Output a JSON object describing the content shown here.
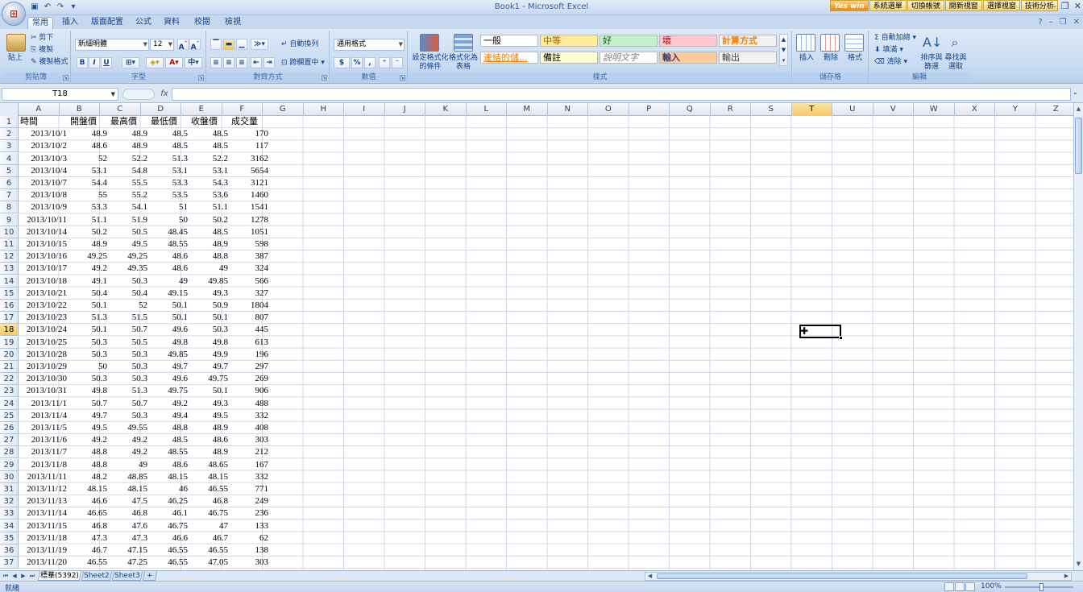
{
  "window": {
    "title": "Book1 - Microsoft Excel",
    "addins": [
      "Yes win",
      "系統選單",
      "切換帳號",
      "開新視窗",
      "選擇視窗",
      "技術分析"
    ]
  },
  "tabs": [
    "常用",
    "插入",
    "版面配置",
    "公式",
    "資料",
    "校閱",
    "檢視"
  ],
  "ribbon": {
    "clipboard": {
      "paste": "貼上",
      "cut": "剪下",
      "copy": "複製",
      "format_painter": "複製格式",
      "label": "剪貼簿"
    },
    "font": {
      "name": "新細明體",
      "size": "12",
      "label": "字型",
      "bold": "B",
      "italic": "I",
      "underline": "U"
    },
    "alignment": {
      "wrap": "自動換列",
      "merge": "跨欄置中",
      "label": "對齊方式"
    },
    "number": {
      "format": "通用格式",
      "label": "數值",
      "currency": "$",
      "percent": "%",
      "comma": ","
    },
    "styles": {
      "conditional": "設定格式化的條件",
      "as_table": "格式化為表格",
      "label": "樣式",
      "cells": [
        {
          "text": "一般",
          "bg": "#ffffff",
          "color": "#000000"
        },
        {
          "text": "中等",
          "bg": "#ffeb9c",
          "color": "#9c6500"
        },
        {
          "text": "好",
          "bg": "#c6efce",
          "color": "#006100"
        },
        {
          "text": "壞",
          "bg": "#ffc7ce",
          "color": "#9c0006"
        },
        {
          "text": "計算方式",
          "bg": "#f2f2f2",
          "color": "#fa7d00"
        },
        {
          "text": "連結的儲...",
          "bg": "#ffffff",
          "color": "#fa7d00"
        },
        {
          "text": "備註",
          "bg": "#ffffcc",
          "color": "#000000"
        },
        {
          "text": "說明文字",
          "bg": "#ffffff",
          "color": "#7f7f7f"
        },
        {
          "text": "輸入",
          "bg": "#ffcc99",
          "color": "#3f3f76"
        },
        {
          "text": "輸出",
          "bg": "#f2f2f2",
          "color": "#3f3f3f"
        }
      ]
    },
    "cells_group": {
      "insert": "插入",
      "delete": "刪除",
      "format": "格式",
      "label": "儲存格"
    },
    "editing": {
      "autosum": "自動加總",
      "fill": "填滿",
      "clear": "清除",
      "sort": "排序與篩選",
      "find": "尋找與選取",
      "label": "編輯"
    }
  },
  "formula_bar": {
    "name_box": "T18",
    "fx": "fx",
    "value": ""
  },
  "columns": [
    "A",
    "B",
    "C",
    "D",
    "E",
    "F",
    "G",
    "H",
    "I",
    "J",
    "K",
    "L",
    "M",
    "N",
    "O",
    "P",
    "Q",
    "R",
    "S",
    "T",
    "U",
    "V",
    "W",
    "X",
    "Y",
    "Z"
  ],
  "selected_column": "T",
  "selected_row": 18,
  "headers": [
    "時間",
    "開盤價",
    "最高價",
    "最低價",
    "收盤價",
    "成交量"
  ],
  "rows": [
    [
      "2013/10/1",
      "48.9",
      "48.9",
      "48.5",
      "48.5",
      "170"
    ],
    [
      "2013/10/2",
      "48.6",
      "48.9",
      "48.5",
      "48.5",
      "117"
    ],
    [
      "2013/10/3",
      "52",
      "52.2",
      "51.3",
      "52.2",
      "3162"
    ],
    [
      "2013/10/4",
      "53.1",
      "54.8",
      "53.1",
      "53.1",
      "5654"
    ],
    [
      "2013/10/7",
      "54.4",
      "55.5",
      "53.3",
      "54.3",
      "3121"
    ],
    [
      "2013/10/8",
      "55",
      "55.2",
      "53.5",
      "53.6",
      "1460"
    ],
    [
      "2013/10/9",
      "53.3",
      "54.1",
      "51",
      "51.1",
      "1541"
    ],
    [
      "2013/10/11",
      "51.1",
      "51.9",
      "50",
      "50.2",
      "1278"
    ],
    [
      "2013/10/14",
      "50.2",
      "50.5",
      "48.45",
      "48.5",
      "1051"
    ],
    [
      "2013/10/15",
      "48.9",
      "49.5",
      "48.55",
      "48.9",
      "598"
    ],
    [
      "2013/10/16",
      "49.25",
      "49.25",
      "48.6",
      "48.8",
      "387"
    ],
    [
      "2013/10/17",
      "49.2",
      "49.35",
      "48.6",
      "49",
      "324"
    ],
    [
      "2013/10/18",
      "49.1",
      "50.3",
      "49",
      "49.85",
      "566"
    ],
    [
      "2013/10/21",
      "50.4",
      "50.4",
      "49.15",
      "49.3",
      "327"
    ],
    [
      "2013/10/22",
      "50.1",
      "52",
      "50.1",
      "50.9",
      "1804"
    ],
    [
      "2013/10/23",
      "51.3",
      "51.5",
      "50.1",
      "50.1",
      "807"
    ],
    [
      "2013/10/24",
      "50.1",
      "50.7",
      "49.6",
      "50.3",
      "445"
    ],
    [
      "2013/10/25",
      "50.3",
      "50.5",
      "49.8",
      "49.8",
      "613"
    ],
    [
      "2013/10/28",
      "50.3",
      "50.3",
      "49.85",
      "49.9",
      "196"
    ],
    [
      "2013/10/29",
      "50",
      "50.3",
      "49.7",
      "49.7",
      "297"
    ],
    [
      "2013/10/30",
      "50.3",
      "50.3",
      "49.6",
      "49.75",
      "269"
    ],
    [
      "2013/10/31",
      "49.8",
      "51.3",
      "49.75",
      "50.1",
      "906"
    ],
    [
      "2013/11/1",
      "50.7",
      "50.7",
      "49.2",
      "49.3",
      "488"
    ],
    [
      "2013/11/4",
      "49.7",
      "50.3",
      "49.4",
      "49.5",
      "332"
    ],
    [
      "2013/11/5",
      "49.5",
      "49.55",
      "48.8",
      "48.9",
      "408"
    ],
    [
      "2013/11/6",
      "49.2",
      "49.2",
      "48.5",
      "48.6",
      "303"
    ],
    [
      "2013/11/7",
      "48.8",
      "49.2",
      "48.55",
      "48.9",
      "212"
    ],
    [
      "2013/11/8",
      "48.8",
      "49",
      "48.6",
      "48.65",
      "167"
    ],
    [
      "2013/11/11",
      "48.2",
      "48.85",
      "48.15",
      "48.15",
      "332"
    ],
    [
      "2013/11/12",
      "48.15",
      "48.15",
      "46",
      "46.55",
      "771"
    ],
    [
      "2013/11/13",
      "46.6",
      "47.5",
      "46.25",
      "46.8",
      "249"
    ],
    [
      "2013/11/14",
      "46.65",
      "46.8",
      "46.1",
      "46.75",
      "236"
    ],
    [
      "2013/11/15",
      "46.8",
      "47.6",
      "46.75",
      "47",
      "133"
    ],
    [
      "2013/11/18",
      "47.3",
      "47.3",
      "46.6",
      "46.7",
      "62"
    ],
    [
      "2013/11/19",
      "46.7",
      "47.15",
      "46.55",
      "46.55",
      "138"
    ],
    [
      "2013/11/20",
      "46.55",
      "47.25",
      "46.55",
      "47.05",
      "303"
    ]
  ],
  "sheets": [
    "標華(5392)",
    "Sheet2",
    "Sheet3"
  ],
  "status": {
    "text": "就緒",
    "zoom": "100%"
  }
}
